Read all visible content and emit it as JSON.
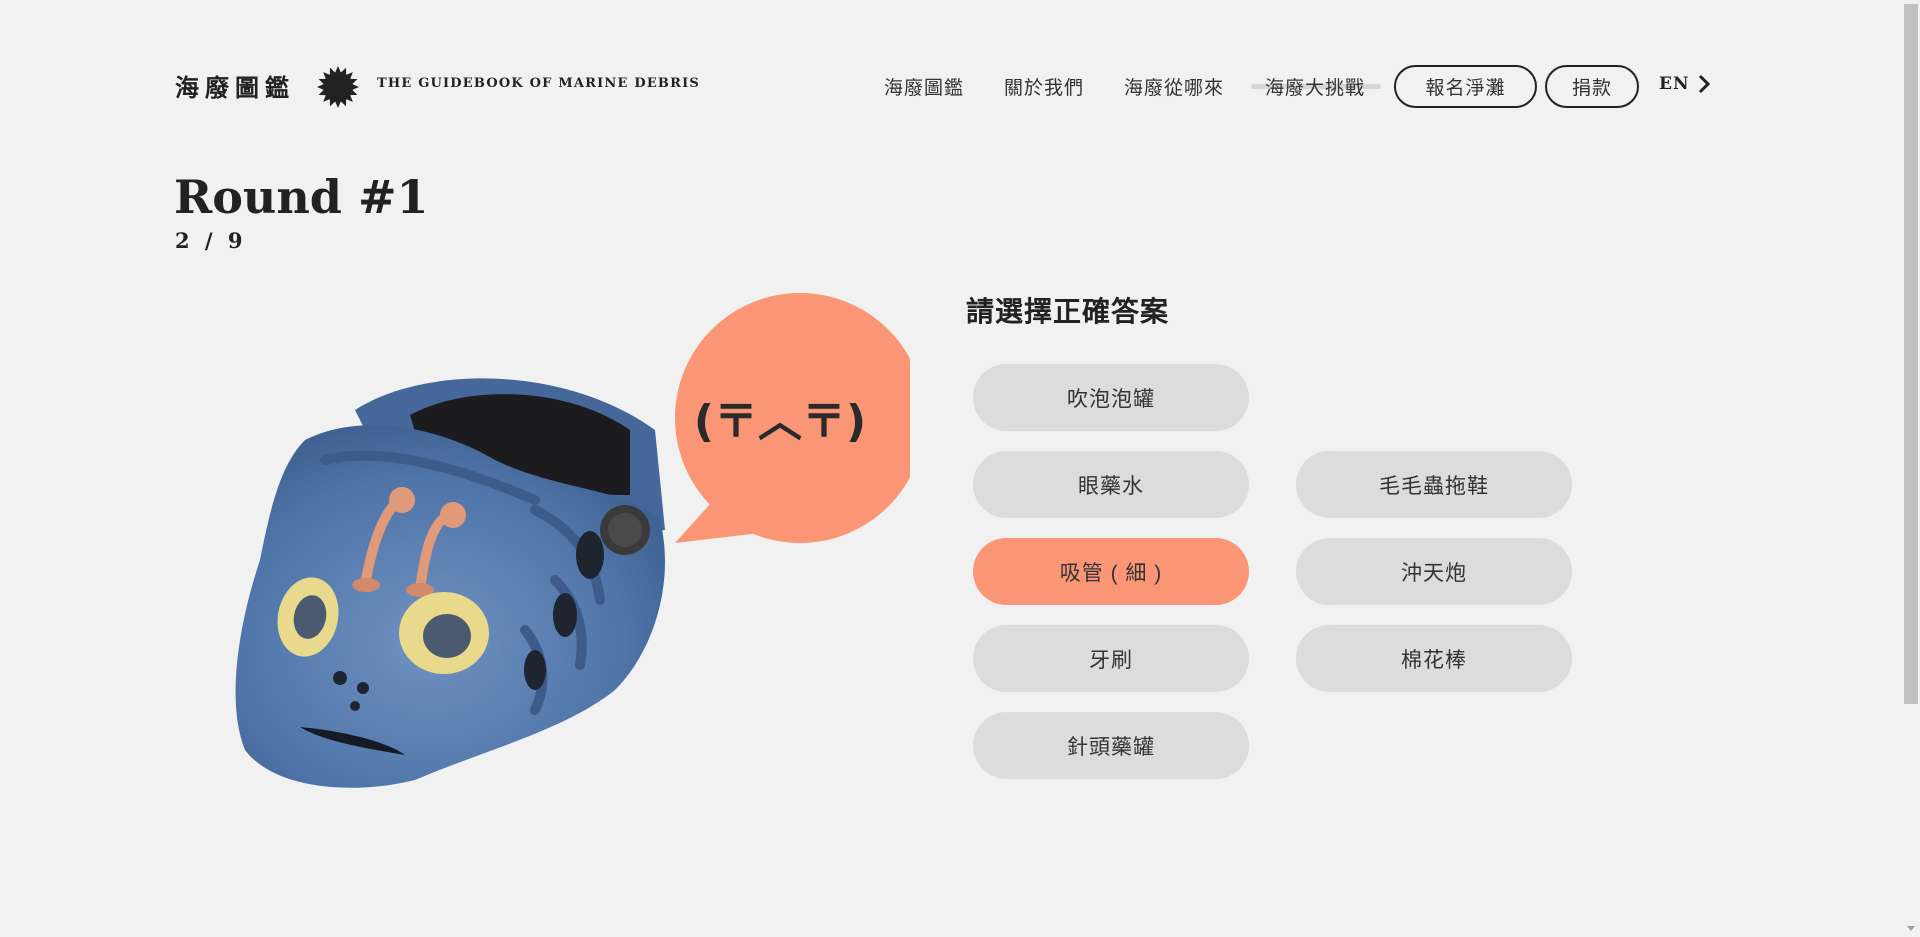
{
  "header": {
    "logo_cn": "海廢圖鑑",
    "logo_en": "THE GUIDEBOOK OF MARINE DEBRIS",
    "nav": [
      "海廢圖鑑",
      "關於我們",
      "海廢從哪來",
      "海廢大挑戰"
    ],
    "buttons": [
      "報名淨灘",
      "捐款"
    ],
    "lang": "EN"
  },
  "round": {
    "title": "Round #1",
    "progress": "2 / 9"
  },
  "bubble": {
    "text": "(〒︿〒)",
    "color": "#fa9676"
  },
  "question": {
    "prompt": "請選擇正確答案",
    "options": [
      {
        "label": "吹泡泡罐",
        "selected": false
      },
      {
        "label": "眼藥水",
        "selected": false
      },
      {
        "label": "毛毛蟲拖鞋",
        "selected": false
      },
      {
        "label": "吸管 ( 細 )",
        "selected": true
      },
      {
        "label": "沖天炮",
        "selected": false
      },
      {
        "label": "牙刷",
        "selected": false
      },
      {
        "label": "棉花棒",
        "selected": false
      },
      {
        "label": "針頭藥罐",
        "selected": false
      }
    ]
  },
  "colors": {
    "background": "#f1f1f1",
    "accent": "#fa9676",
    "option_bg": "#dcdcdc",
    "text": "#222222"
  }
}
